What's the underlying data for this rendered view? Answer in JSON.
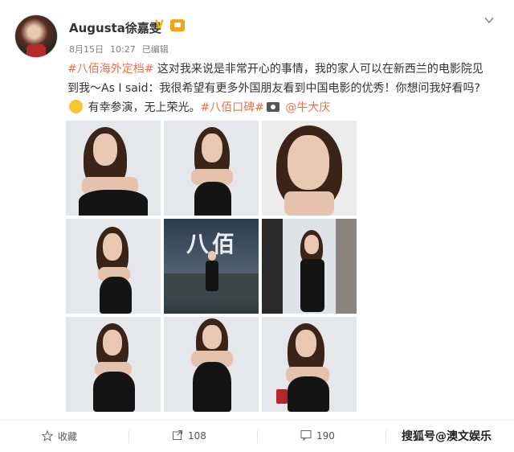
{
  "post": {
    "username": "Augusta徐嘉雯",
    "date": "8月15日",
    "time": "10:27",
    "edited": "已编辑",
    "text": {
      "tag1": "#八佰海外定档#",
      "part1": " 这对我来说是非常开心的事情，我的家人可以在新西兰的电影院见到我～As I said：我很希望有更多外国朋友看到中国电影的优秀！你想问我好看吗?",
      "part2": " 有幸参演，无上荣光。",
      "tag2": "#八佰口碑#",
      "part3": " ",
      "mention": "@牛大庆"
    },
    "poster_title": "八佰"
  },
  "footer": {
    "favorite_label": "收藏",
    "repost_count": "108",
    "comment_count": "190",
    "like_label": ""
  },
  "watermark": "搜狐号@澳文娱乐",
  "colors": {
    "accent": "#eb7350",
    "text": "#333333",
    "muted": "#808080"
  },
  "icons": [
    "avatar",
    "verified-icon",
    "vip-icon",
    "chevron-down-icon",
    "thinking-emoji-icon",
    "camera-icon",
    "star-icon",
    "repost-icon",
    "comment-icon"
  ]
}
